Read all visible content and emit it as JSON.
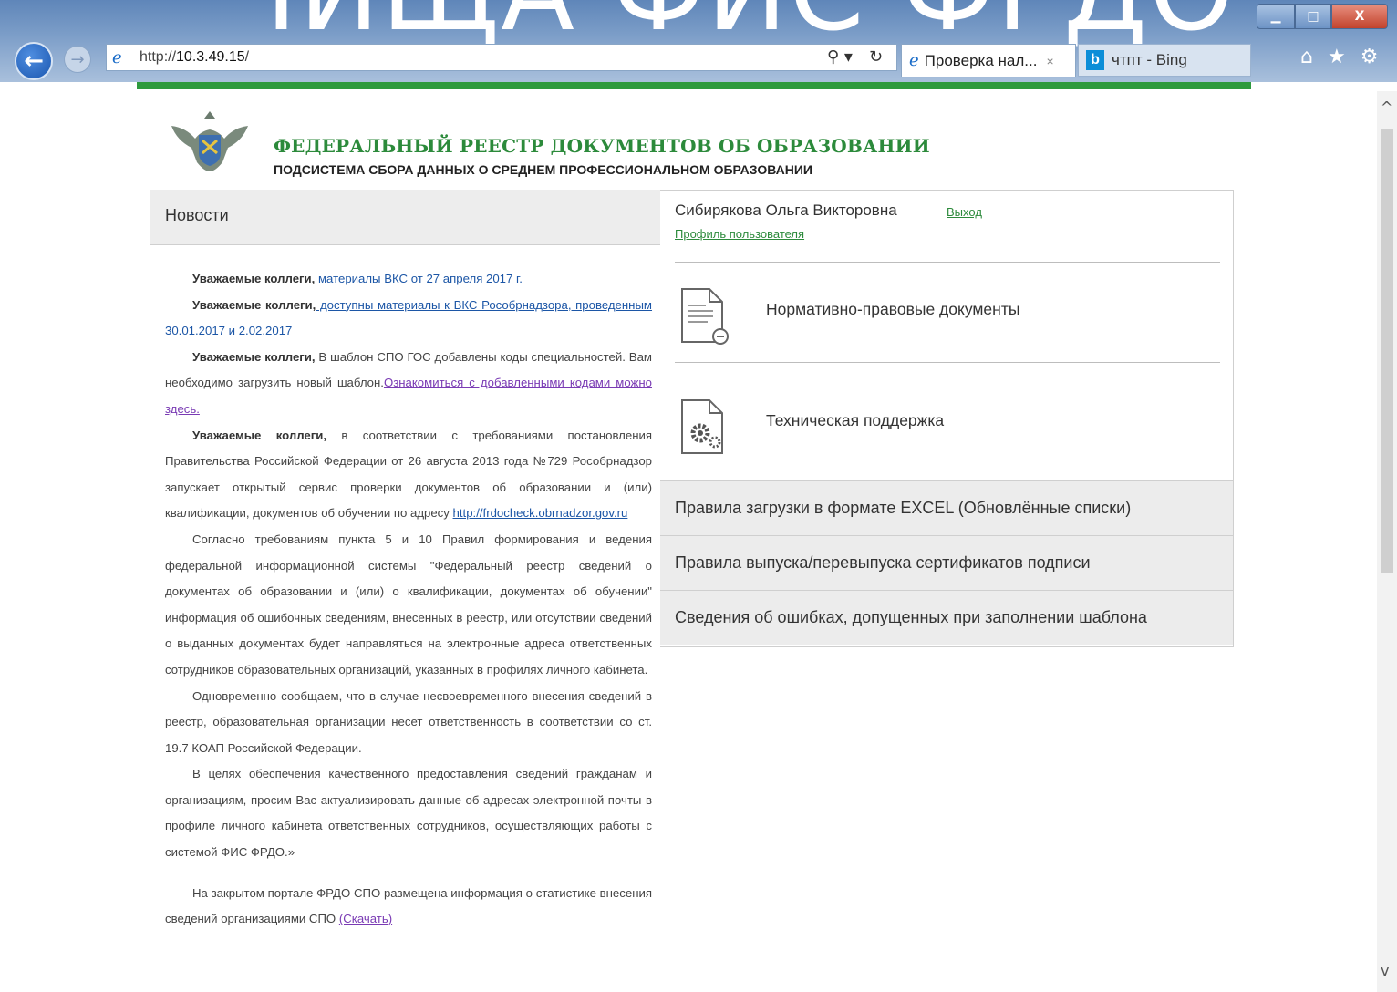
{
  "browser": {
    "overlay_text": "ЧИЩА ФИС ФРДО",
    "url_prefix": "http://",
    "url_host": "10.3.49.15",
    "url_suffix": "/",
    "tabs": [
      {
        "label": "Проверка нал...",
        "close": "×"
      },
      {
        "label": "чтпт - Bing"
      }
    ],
    "window_buttons": {
      "minimize": "▁",
      "maximize": "□",
      "close": "X"
    },
    "icons": [
      "back-arrow-icon",
      "forward-arrow-icon",
      "ie-logo-icon",
      "search-icon",
      "refresh-icon",
      "home-icon",
      "favorites-star-icon",
      "settings-gear-icon"
    ],
    "accent_colors": {
      "chrome": "#6d93c5",
      "close": "#c2432d"
    }
  },
  "header": {
    "title": "ФЕДЕРАЛЬНЫЙ РЕЕСТР ДОКУМЕНТОВ ОБ ОБРАЗОВАНИИ",
    "subtitle": "ПОДСИСТЕМА СБОРА ДАННЫХ О СРЕДНЕМ ПРОФЕССИОНАЛЬНОМ ОБРАЗОВАНИИ",
    "brand_color": "#2e9a3d"
  },
  "news": {
    "heading": "Новости",
    "p1_bold": "Уважаемые коллеги,",
    "p1_link": " материалы ВКС от 27 апреля 2017 г.",
    "p2_bold": "Уважаемые коллеги,",
    "p2_link": " доступны материалы к ВКС Рособрнадзора, проведенным 30.01.2017 и 2.02.2017",
    "p3_bold": "Уважаемые коллеги,",
    "p3_text": " В шаблон СПО ГОС добавлены коды специальностей. Вам необходимо загрузить новый шаблон.",
    "p3_link": "Ознакомиться с добавленными кодами можно здесь.",
    "p4_bold": "Уважаемые коллеги,",
    "p4_text": " в соответствии с требованиями постановления Правительства Российской Федерации от 26 августа 2013 года №729 Рособрнадзор запускает открытый сервис проверки документов об образовании и (или) квалификации, документов об обучении по адресу ",
    "p4_link": "http://frdocheck.obrnadzor.gov.ru",
    "p5_text": "Согласно требованиям пункта 5 и 10 Правил формирования и ведения федеральной информационной системы \"Федеральный реестр сведений о документах об образовании и (или) о квалификации, документах об обучении\" информация об ошибочных сведениям, внесенных в реестр, или отсутствии сведений о выданных документах будет направляться на электронные адреса ответственных сотрудников образовательных организаций, указанных в профилях личного кабинета.",
    "p6_text": "Одновременно сообщаем, что в случае несвоевременного внесения сведений в реестр, образовательная организации несет ответственность в соответствии со ст. 19.7 КОАП Российской Федерации.",
    "p7_text": "В целях обеспечения качественного предоставления сведений гражданам и организациям, просим Вас актуализировать данные об адресах электронной почты в профиле личного кабинета ответственных сотрудников, осуществляющих работы с системой ФИС ФРДО.»",
    "p8_text": "На закрытом портале ФРДО СПО размещена информация о статистике внесения сведений организациями СПО ",
    "p8_link": "(Скачать)"
  },
  "user": {
    "name": "Сибирякова Ольга Викторовна",
    "logout": "Выход",
    "profile": "Профиль пользователя"
  },
  "menu": {
    "item1": "Нормативно-правовые документы",
    "item2": "Техническая поддержка",
    "gray_items": [
      "Правила загрузки в формате EXCEL (Обновлённые списки)",
      "Правила выпуска/перевыпуска сертификатов подписи",
      "Сведения об ошибках, допущенных при заполнении шаблона"
    ]
  },
  "scrollbar": {
    "up": "^",
    "down": "v",
    "position": 0.1
  }
}
